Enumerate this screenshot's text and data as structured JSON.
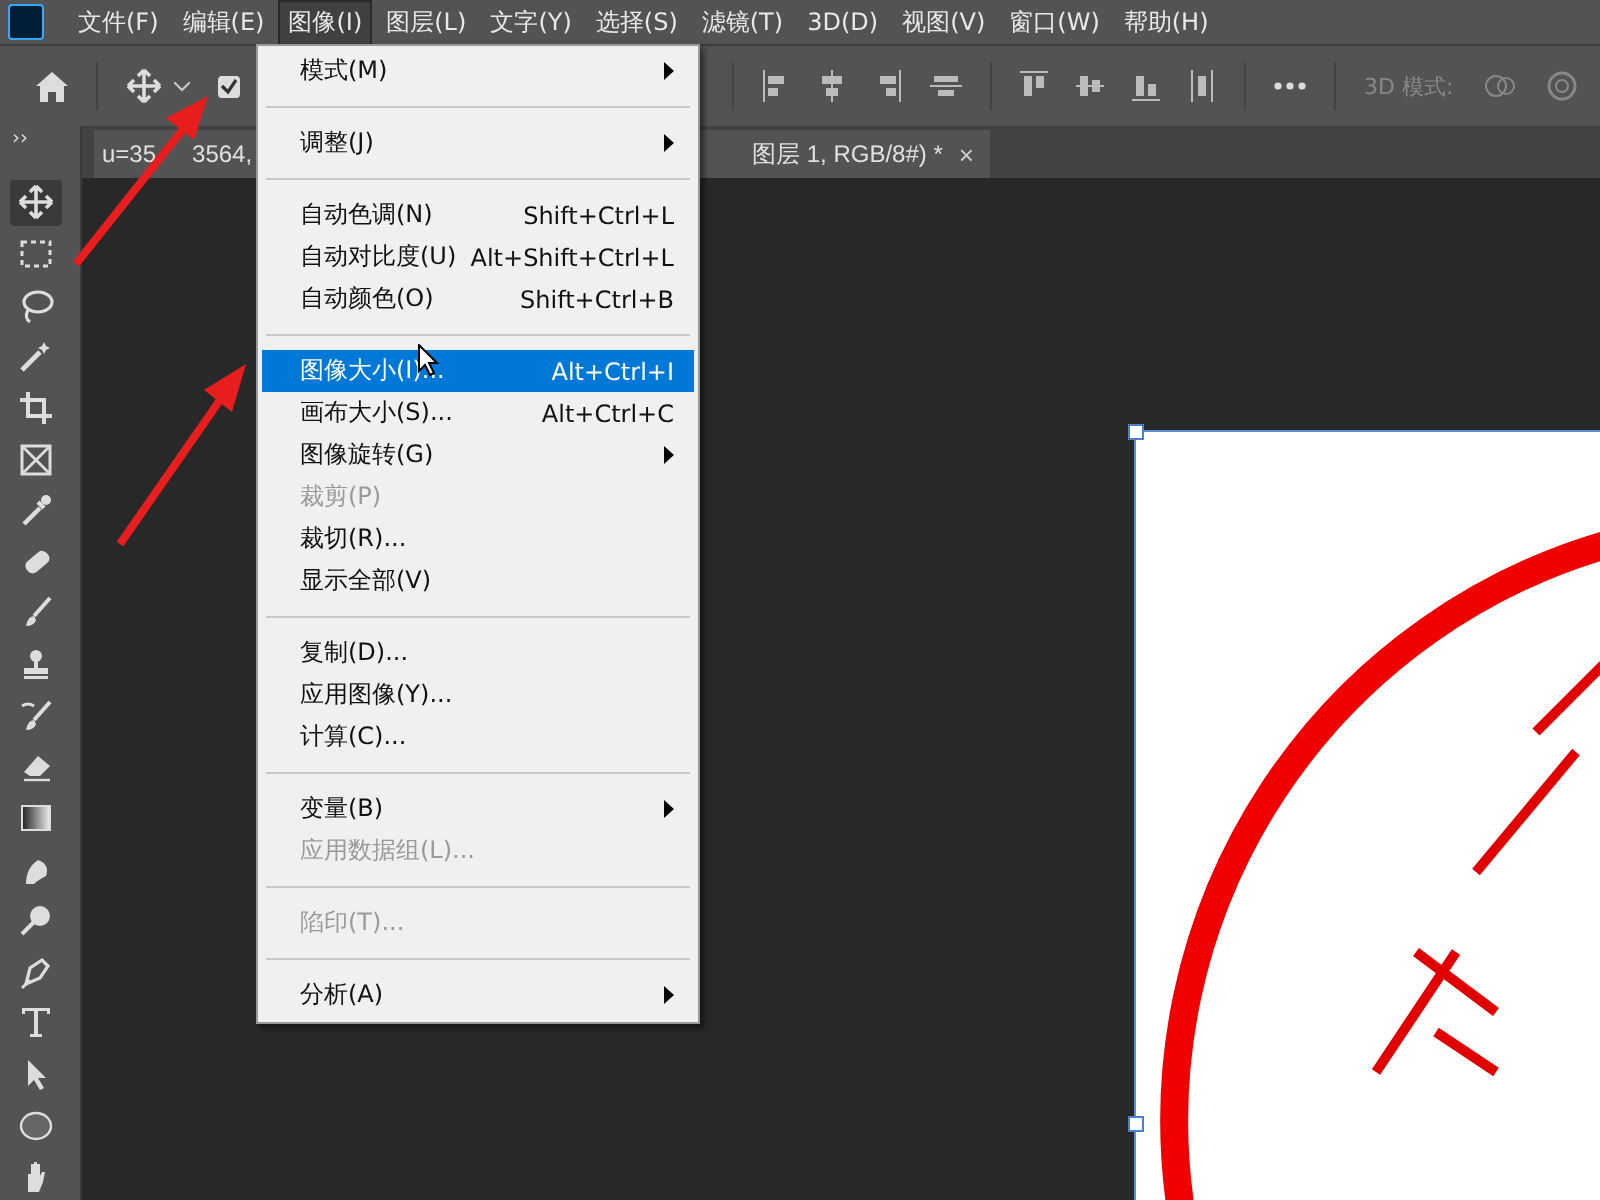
{
  "menu_bar": {
    "items": [
      {
        "label": "文件(F)",
        "selected": false
      },
      {
        "label": "编辑(E)",
        "selected": false
      },
      {
        "label": "图像(I)",
        "selected": true
      },
      {
        "label": "图层(L)",
        "selected": false
      },
      {
        "label": "文字(Y)",
        "selected": false
      },
      {
        "label": "选择(S)",
        "selected": false
      },
      {
        "label": "滤镜(T)",
        "selected": false
      },
      {
        "label": "3D(D)",
        "selected": false
      },
      {
        "label": "视图(V)",
        "selected": false
      },
      {
        "label": "窗口(W)",
        "selected": false
      },
      {
        "label": "帮助(H)",
        "selected": false
      }
    ]
  },
  "options_bar": {
    "auto_select_checked": true,
    "mode_label": "3D 模式:"
  },
  "tab_bar": {
    "collapse": "››",
    "tab": {
      "title_start": "u=35",
      "title_mid": "3564,",
      "title_end": "图层 1, RGB/8#) *",
      "close": "×"
    }
  },
  "tools": [
    {
      "kind": "move",
      "selected": true
    },
    {
      "kind": "marquee",
      "selected": false
    },
    {
      "kind": "lasso",
      "selected": false
    },
    {
      "kind": "wand",
      "selected": false
    },
    {
      "kind": "crop",
      "selected": false
    },
    {
      "kind": "frame",
      "selected": false
    },
    {
      "kind": "eyedropper",
      "selected": false
    },
    {
      "kind": "healing",
      "selected": false
    },
    {
      "kind": "brush",
      "selected": false
    },
    {
      "kind": "stamp",
      "selected": false
    },
    {
      "kind": "history",
      "selected": false
    },
    {
      "kind": "eraser",
      "selected": false
    },
    {
      "kind": "gradient",
      "selected": false
    },
    {
      "kind": "blur",
      "selected": false
    },
    {
      "kind": "dodge",
      "selected": false
    },
    {
      "kind": "pen",
      "selected": false
    },
    {
      "kind": "type",
      "selected": false
    },
    {
      "kind": "select",
      "selected": false
    },
    {
      "kind": "ellipse",
      "selected": false
    },
    {
      "kind": "hand",
      "selected": false
    }
  ],
  "image_menu": {
    "items": [
      {
        "kind": "item",
        "label": "模式(M)",
        "submenu": true,
        "disabled": false,
        "selected": false
      },
      {
        "kind": "separator"
      },
      {
        "kind": "item",
        "label": "调整(J)",
        "submenu": true,
        "disabled": false,
        "selected": false
      },
      {
        "kind": "separator"
      },
      {
        "kind": "item",
        "label": "自动色调(N)",
        "shortcut": "Shift+Ctrl+L",
        "disabled": false,
        "selected": false
      },
      {
        "kind": "item",
        "label": "自动对比度(U)",
        "shortcut": "Alt+Shift+Ctrl+L",
        "disabled": false,
        "selected": false
      },
      {
        "kind": "item",
        "label": "自动颜色(O)",
        "shortcut": "Shift+Ctrl+B",
        "disabled": false,
        "selected": false
      },
      {
        "kind": "separator"
      },
      {
        "kind": "item",
        "label": "图像大小(I)...",
        "shortcut": "Alt+Ctrl+I",
        "disabled": false,
        "selected": true
      },
      {
        "kind": "item",
        "label": "画布大小(S)...",
        "shortcut": "Alt+Ctrl+C",
        "disabled": false,
        "selected": false
      },
      {
        "kind": "item",
        "label": "图像旋转(G)",
        "submenu": true,
        "disabled": false,
        "selected": false
      },
      {
        "kind": "item",
        "label": "裁剪(P)",
        "disabled": true,
        "selected": false
      },
      {
        "kind": "item",
        "label": "裁切(R)...",
        "disabled": false,
        "selected": false
      },
      {
        "kind": "item",
        "label": "显示全部(V)",
        "disabled": false,
        "selected": false
      },
      {
        "kind": "separator"
      },
      {
        "kind": "item",
        "label": "复制(D)...",
        "disabled": false,
        "selected": false
      },
      {
        "kind": "item",
        "label": "应用图像(Y)...",
        "disabled": false,
        "selected": false
      },
      {
        "kind": "item",
        "label": "计算(C)...",
        "disabled": false,
        "selected": false
      },
      {
        "kind": "separator"
      },
      {
        "kind": "item",
        "label": "变量(B)",
        "submenu": true,
        "disabled": false,
        "selected": false
      },
      {
        "kind": "item",
        "label": "应用数据组(L)...",
        "disabled": true,
        "selected": false
      },
      {
        "kind": "separator"
      },
      {
        "kind": "item",
        "label": "陷印(T)...",
        "disabled": true,
        "selected": false
      },
      {
        "kind": "separator"
      },
      {
        "kind": "item",
        "label": "分析(A)",
        "submenu": true,
        "disabled": false,
        "selected": false
      }
    ]
  }
}
